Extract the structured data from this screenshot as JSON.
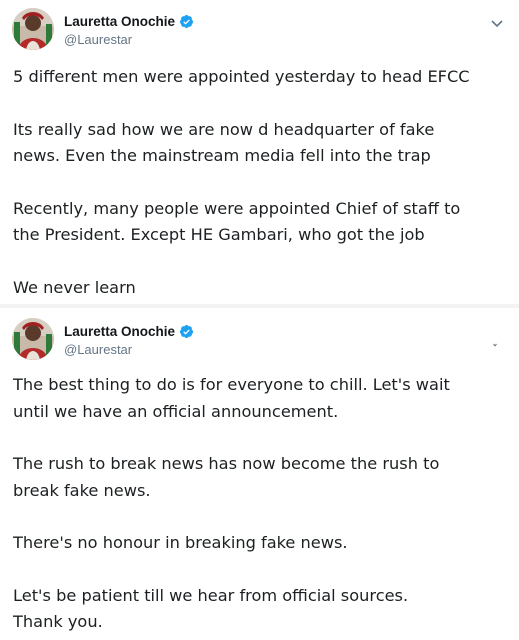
{
  "tweets": [
    {
      "author": {
        "display_name": "Lauretta Onochie",
        "handle": "@Laurestar",
        "verified": true
      },
      "menu_icon": "chevron-down-icon",
      "paragraphs": [
        [
          "5 different men were appointed yesterday to head EFCC"
        ],
        [
          "Its really sad how we are now d headquarter of fake",
          "news. Even the mainstream media fell into the trap"
        ],
        [
          "Recently, many people were appointed Chief of staff to",
          "the President. Except HE Gambari, who got the job"
        ],
        [
          "We never learn"
        ]
      ]
    },
    {
      "author": {
        "display_name": "Lauretta Onochie",
        "handle": "@Laurestar",
        "verified": true
      },
      "menu_icon": "chevron-down-icon",
      "paragraphs": [
        [
          "The best thing to do is for everyone to chill. Let's wait",
          "until we have an official announcement."
        ],
        [
          "The rush to break news has now become the rush to",
          "break fake news."
        ],
        [
          "There's no honour in breaking fake news."
        ],
        [
          "Let's be patient till we hear from official sources.",
          "Thank you."
        ]
      ]
    }
  ],
  "colors": {
    "name": "#14171a",
    "handle": "#657786",
    "verified_badge": "#1da1f2",
    "separator": "#f3f3f3"
  }
}
